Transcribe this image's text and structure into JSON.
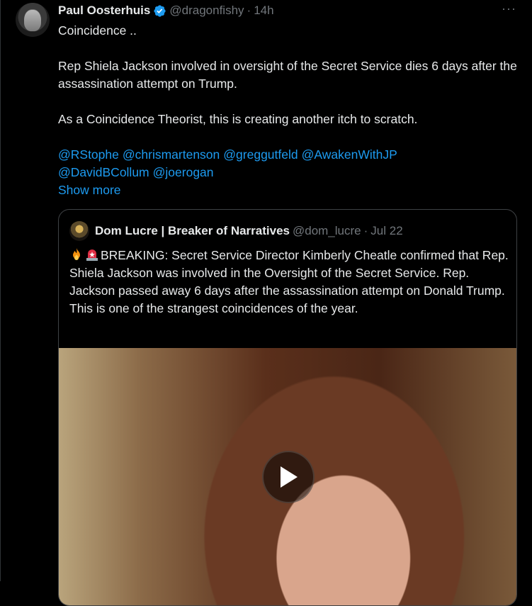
{
  "tweet": {
    "author_name": "Paul Oosterhuis",
    "handle": "@dragonfishy",
    "separator": "·",
    "time": "14h",
    "more_icon": "···",
    "line1": "Coincidence ..",
    "line2": "Rep Shiela Jackson involved in oversight of the Secret Service dies 6 days after the assassination attempt on Trump.",
    "line3": "As a Coincidence Theorist, this is creating another itch to scratch.",
    "mentions": [
      "@RStophe",
      "@chrismartenson",
      "@greggutfeld",
      "@AwakenWithJP",
      "@DavidBCollum",
      "@joerogan"
    ],
    "show_more": "Show more"
  },
  "quote": {
    "author_name": "Dom Lucre | Breaker of Narratives",
    "handle": "@dom_lucre",
    "separator": "·",
    "date": "Jul 22",
    "text": "BREAKING: Secret Service Director Kimberly Cheatle confirmed that Rep.  Shiela Jackson was involved in the Oversight of the Secret Service. Rep. Jackson passed away 6 days after the assassination attempt on Donald Trump. This is one of the strangest coincidences of the year."
  },
  "colors": {
    "background": "#000000",
    "text": "#e7e9ea",
    "muted": "#71767b",
    "link": "#1d9bf0",
    "border": "#3e4144"
  },
  "icons": {
    "verified": "verified-badge-icon",
    "fire": "fire-icon",
    "siren": "siren-icon",
    "play": "play-icon"
  }
}
